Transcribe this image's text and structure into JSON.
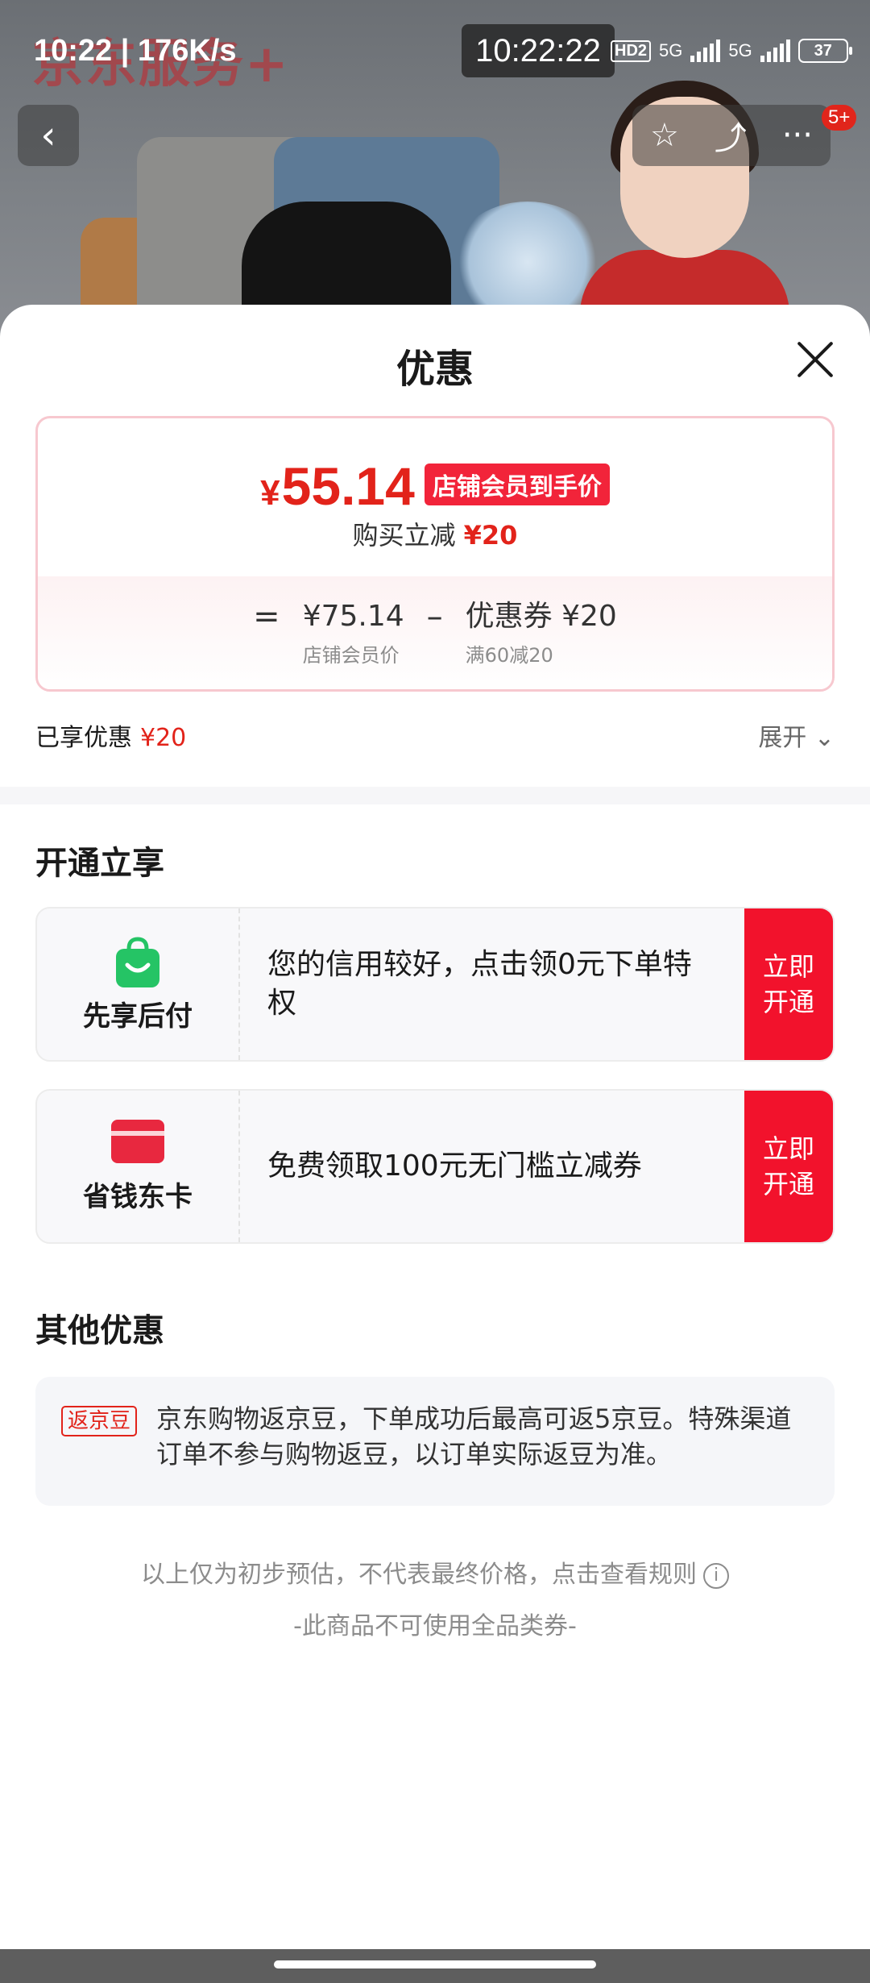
{
  "status_bar": {
    "time": "10:22 | 176K/s",
    "clock": "10:22:22",
    "hd": "HD2",
    "net1": "5G",
    "net2": "5G",
    "battery": "37"
  },
  "background": {
    "shop_title": "京东服务+"
  },
  "nav": {
    "back_glyph": "‹",
    "star_glyph": "☆",
    "share_glyph": "⤴",
    "more_glyph": "···",
    "badge": "5+"
  },
  "sheet": {
    "title": "优惠",
    "price": {
      "yen": "¥",
      "integer": "55.14",
      "tag": "店铺会员到手价",
      "sub_label": "购买立减",
      "sub_value": "¥20",
      "equals": "=",
      "minus": "–",
      "member_price": "¥75.14",
      "member_label": "店铺会员价",
      "coupon_value": "优惠券 ¥20",
      "coupon_label": "满60减20"
    },
    "enjoyed_label": "已享优惠",
    "enjoyed_value": "¥20",
    "expand_label": "展开 ⌄"
  },
  "open_section": {
    "title": "开通立享",
    "items": [
      {
        "name": "先享后付",
        "desc": "您的信用较好，点击领0元下单特权",
        "button": "立即开通",
        "icon": "shopping-bag-icon",
        "icon_color": "#25c465"
      },
      {
        "name": "省钱东卡",
        "desc": "免费领取100元无门槛立减券",
        "button": "立即开通",
        "icon": "card-icon",
        "icon_color": "#e8283f"
      }
    ]
  },
  "other_section": {
    "title": "其他优惠",
    "tag": "返京豆",
    "text": "京东购物返京豆，下单成功后最高可返5京豆。特殊渠道订单不参与购物返豆，以订单实际返豆为准。"
  },
  "footer": {
    "notice": "以上仅为初步预估，不代表最终价格，点击查看规则",
    "info_glyph": "i",
    "note": "-此商品不可使用全品类券-"
  },
  "colors": {
    "accent_red": "#e2231a",
    "button_red": "#f2122c",
    "green": "#25c465"
  }
}
